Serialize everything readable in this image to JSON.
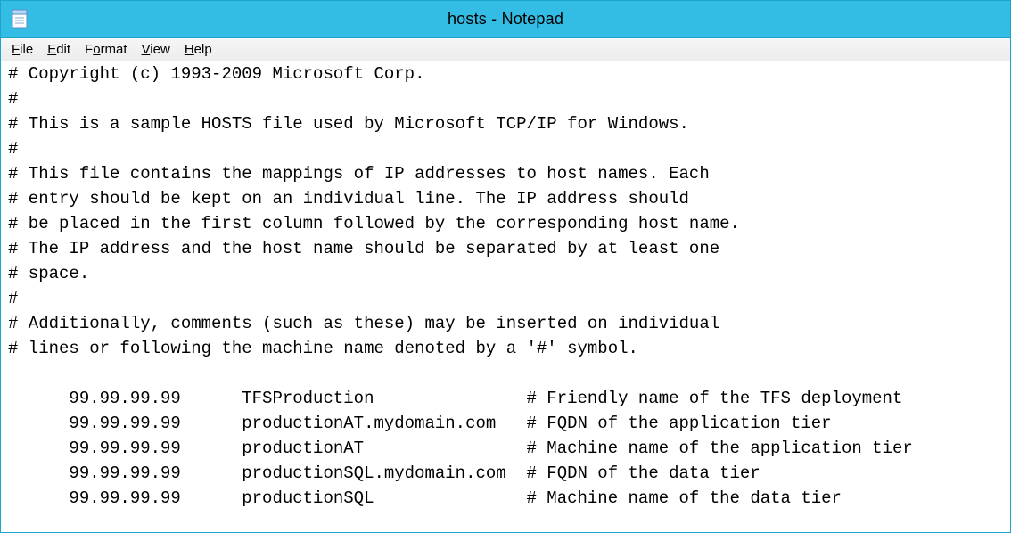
{
  "title": "hosts - Notepad",
  "menu": {
    "file": {
      "label": "File",
      "mn": "F"
    },
    "edit": {
      "label": "Edit",
      "mn": "E"
    },
    "format": {
      "label": "Format",
      "mn": "o"
    },
    "view": {
      "label": "View",
      "mn": "V"
    },
    "help": {
      "label": "Help",
      "mn": "H"
    }
  },
  "editor": {
    "content": "# Copyright (c) 1993-2009 Microsoft Corp.\n#\n# This is a sample HOSTS file used by Microsoft TCP/IP for Windows.\n#\n# This file contains the mappings of IP addresses to host names. Each\n# entry should be kept on an individual line. The IP address should\n# be placed in the first column followed by the corresponding host name.\n# The IP address and the host name should be separated by at least one\n# space.\n#\n# Additionally, comments (such as these) may be inserted on individual\n# lines or following the machine name denoted by a '#' symbol.\n\n      99.99.99.99      TFSProduction               # Friendly name of the TFS deployment\n      99.99.99.99      productionAT.mydomain.com   # FQDN of the application tier\n      99.99.99.99      productionAT                # Machine name of the application tier\n      99.99.99.99      productionSQL.mydomain.com  # FQDN of the data tier\n      99.99.99.99      productionSQL               # Machine name of the data tier"
  }
}
